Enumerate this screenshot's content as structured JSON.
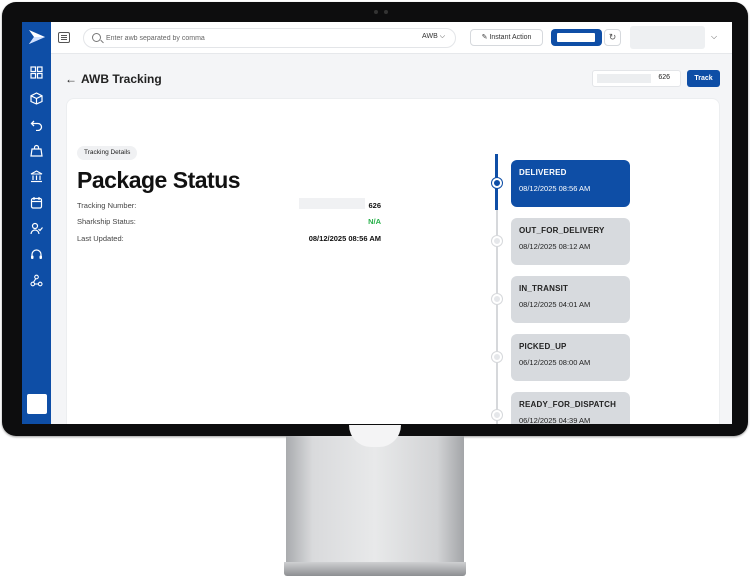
{
  "search": {
    "placeholder": "Enter awb separated by comma",
    "type_selected": "AWB"
  },
  "toolbar": {
    "instant_action_label": "Instant Action"
  },
  "header": {
    "title": "AWB Tracking",
    "track_input_value": "626",
    "track_button_label": "Track"
  },
  "details": {
    "badge": "Tracking Details",
    "title": "Package Status",
    "tracking_number_label": "Tracking Number:",
    "tracking_number_value": "626",
    "sharkship_status_label": "Sharkship Status:",
    "sharkship_status_value": "N/A",
    "last_updated_label": "Last Updated:",
    "last_updated_value": "08/12/2025 08:56 AM"
  },
  "timeline": [
    {
      "status": "DELIVERED",
      "date": "08/12/2025 08:56 AM",
      "active": true
    },
    {
      "status": "OUT_FOR_DELIVERY",
      "date": "08/12/2025 08:12 AM",
      "active": false
    },
    {
      "status": "IN_TRANSIT",
      "date": "08/12/2025 04:01 AM",
      "active": false
    },
    {
      "status": "PICKED_UP",
      "date": "06/12/2025 08:00 AM",
      "active": false
    },
    {
      "status": "READY_FOR_DISPATCH",
      "date": "06/12/2025 04:39 AM",
      "active": false
    }
  ],
  "colors": {
    "brand": "#0e4ea6",
    "success": "#27b14a"
  }
}
